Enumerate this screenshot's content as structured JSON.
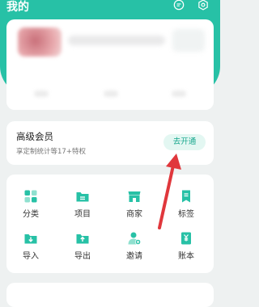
{
  "header": {
    "title": "我的",
    "message_icon": "chat-bubble-icon",
    "settings_icon": "gear-icon"
  },
  "premium": {
    "title": "高级会员",
    "subtitle": "享定制统计等17+特权",
    "button_label": "去开通"
  },
  "features": [
    {
      "label": "分类",
      "icon": "category-grid-icon"
    },
    {
      "label": "项目",
      "icon": "folder-icon"
    },
    {
      "label": "商家",
      "icon": "store-icon"
    },
    {
      "label": "标签",
      "icon": "tag-icon"
    },
    {
      "label": "导入",
      "icon": "import-icon"
    },
    {
      "label": "导出",
      "icon": "export-icon"
    },
    {
      "label": "邀请",
      "icon": "invite-user-icon"
    },
    {
      "label": "账本",
      "icon": "ledger-icon"
    }
  ],
  "colors": {
    "accent": "#27c1a6",
    "accent_dark": "#17a78d",
    "arrow": "#e0373c",
    "background": "#eef1f1"
  }
}
